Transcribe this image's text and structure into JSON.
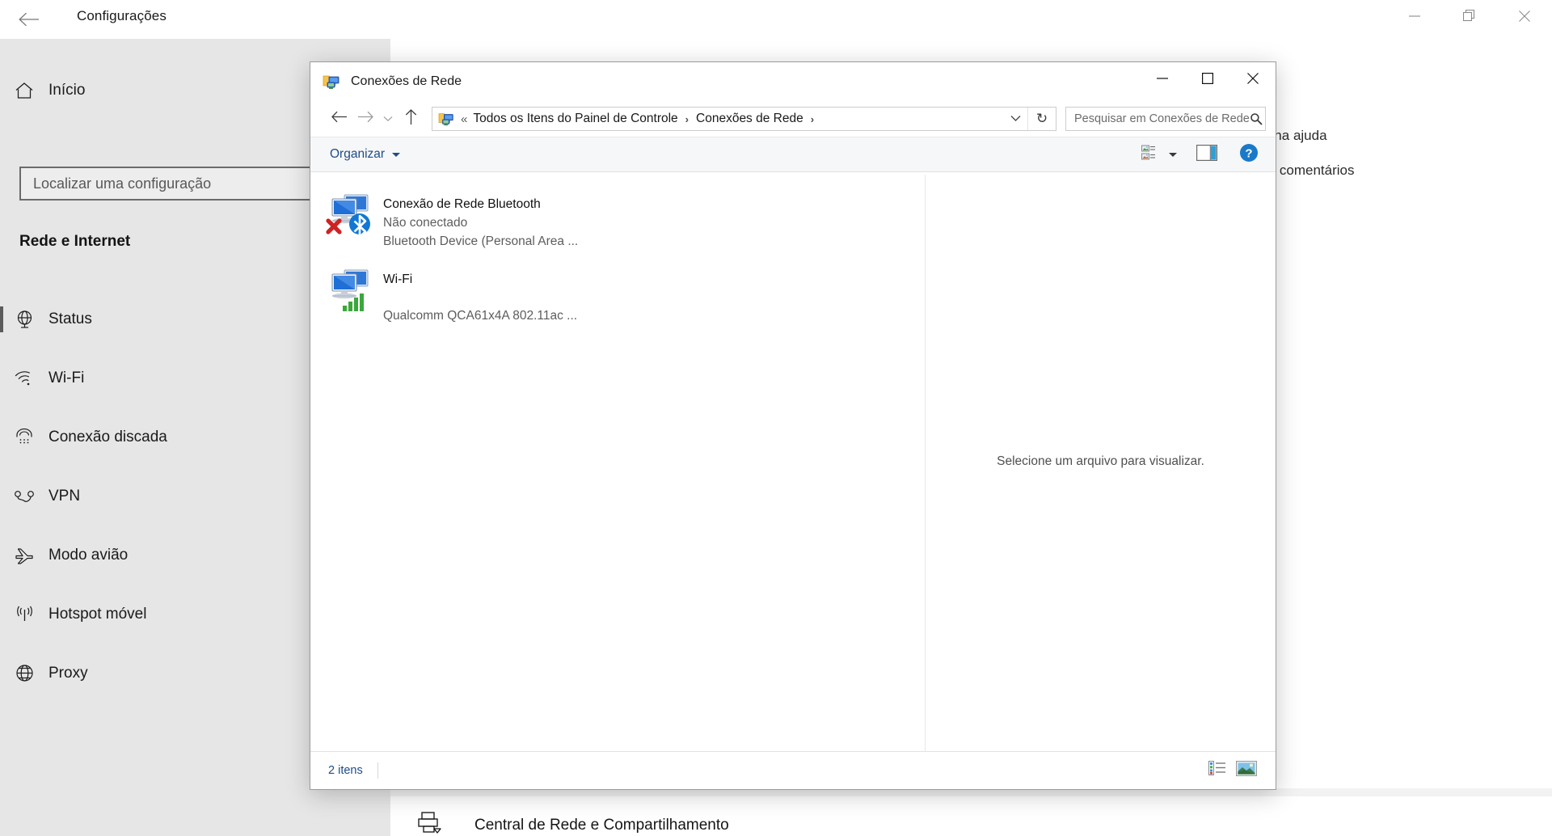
{
  "settings": {
    "title": "Configurações",
    "back_icon": "arrow-left-icon",
    "window_controls": [
      {
        "name": "minimize",
        "glyph": "minimize-icon"
      },
      {
        "name": "restore",
        "glyph": "restore-icon"
      },
      {
        "name": "close",
        "glyph": "close-icon"
      }
    ],
    "home": {
      "label": "Início",
      "icon": "home-icon"
    },
    "search": {
      "placeholder": "Localizar uma configuração",
      "value": ""
    },
    "section_title": "Rede e Internet",
    "nav_items": [
      {
        "label": "Status",
        "icon": "globe-network-icon",
        "selected": true
      },
      {
        "label": "Wi-Fi",
        "icon": "wifi-icon",
        "selected": false
      },
      {
        "label": "Conexão discada",
        "icon": "dialup-phone-icon",
        "selected": false
      },
      {
        "label": "VPN",
        "icon": "vpn-key-icon",
        "selected": false
      },
      {
        "label": "Modo avião",
        "icon": "airplane-icon",
        "selected": false
      },
      {
        "label": "Hotspot móvel",
        "icon": "hotspot-broadcast-icon",
        "selected": false
      },
      {
        "label": "Proxy",
        "icon": "globe-icon",
        "selected": false
      }
    ],
    "right_links": [
      {
        "label": "Obtenha ajuda"
      },
      {
        "label": "Enviar comentários"
      }
    ],
    "bottom_link": {
      "label": "Central de Rede e Compartilhamento",
      "icon": "network-sharing-icon"
    }
  },
  "explorer": {
    "title": "Conexões de Rede",
    "title_icon": "network-connections-folder-icon",
    "window_controls": [
      {
        "name": "minimize",
        "glyph": "minimize-icon"
      },
      {
        "name": "maximize",
        "glyph": "maximize-icon"
      },
      {
        "name": "close",
        "glyph": "close-icon"
      }
    ],
    "nav": {
      "back_icon": "arrow-left-icon",
      "forward_icon": "arrow-right-icon",
      "recent_icon": "chevron-down-icon",
      "up_icon": "arrow-up-icon"
    },
    "address": {
      "icon": "network-connections-folder-icon",
      "overflow": "«",
      "crumbs": [
        {
          "label": "Todos os Itens do Painel de Controle"
        },
        {
          "label": "Conexões de Rede"
        }
      ],
      "dropdown_icon": "chevron-down-icon",
      "refresh_icon": "refresh-icon",
      "refresh_glyph": "↻"
    },
    "search": {
      "placeholder": "Pesquisar em Conexões de Rede",
      "value": "",
      "icon": "search-icon"
    },
    "toolbar": {
      "organize_label": "Organizar",
      "view_icon": "change-view-icon",
      "view_caret_icon": "chevron-down-icon",
      "preview_pane_icon": "preview-pane-icon",
      "help_icon": "help-icon",
      "help_glyph": "?"
    },
    "items": [
      {
        "name": "Conexão de Rede Bluetooth",
        "status": "Não conectado",
        "device": "Bluetooth Device (Personal Area ...",
        "icon": "network-adapter-icon",
        "overlay": "bluetooth-disconnected-icon"
      },
      {
        "name": "Wi-Fi",
        "status": "",
        "device": "Qualcomm QCA61x4A 802.11ac ...",
        "icon": "network-adapter-icon",
        "overlay": "wifi-signal-icon"
      }
    ],
    "preview": {
      "text": "Selecione um arquivo para visualizar."
    },
    "status": {
      "item_count": "2 itens",
      "details_view_icon": "details-view-icon",
      "large_icons_view_icon": "large-icons-view-icon"
    }
  }
}
